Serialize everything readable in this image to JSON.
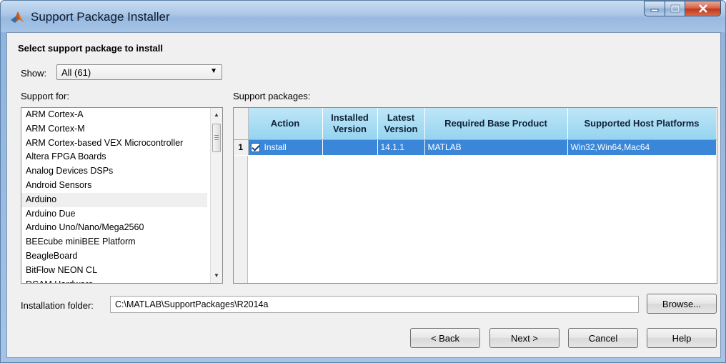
{
  "window": {
    "title": "Support Package Installer",
    "app_icon": "matlab-logo-icon",
    "controls": {
      "minimize_icon": "minimize-icon",
      "maximize_icon": "maximize-icon",
      "close_icon": "close-icon"
    }
  },
  "heading": "Select support package to install",
  "show": {
    "label": "Show:",
    "selected": "All (61)",
    "icon": "dropdown-arrow-icon"
  },
  "support_for": {
    "label": "Support for:",
    "items": [
      "ARM Cortex-A",
      "ARM Cortex-M",
      "ARM Cortex-based VEX Microcontroller",
      "Altera FPGA Boards",
      "Analog Devices DSPs",
      "Android Sensors",
      "Arduino",
      "Arduino Due",
      "Arduino Uno/Nano/Mega2560",
      "BEEcube miniBEE Platform",
      "BeagleBoard",
      "BitFlow NEON CL",
      "DCAM Hardware"
    ],
    "selected_index": 6
  },
  "support_packages": {
    "label": "Support packages:",
    "columns": [
      "Action",
      "Installed Version",
      "Latest Version",
      "Required Base Product",
      "Supported Host Platforms"
    ],
    "rows": [
      {
        "num": "1",
        "checked": true,
        "action": "Install",
        "installed_version": "",
        "latest_version": "14.1.1",
        "base_product": "MATLAB",
        "platforms": "Win32,Win64,Mac64"
      }
    ]
  },
  "installation_folder": {
    "label": "Installation folder:",
    "value": "C:\\MATLAB\\SupportPackages\\R2014a"
  },
  "buttons": {
    "browse": "Browse...",
    "back": "< Back",
    "next": "Next >",
    "cancel": "Cancel",
    "help": "Help"
  },
  "colors": {
    "selection": "#3a86d8",
    "header": "#96d4f0",
    "client_bg": "#f0f0f0"
  }
}
